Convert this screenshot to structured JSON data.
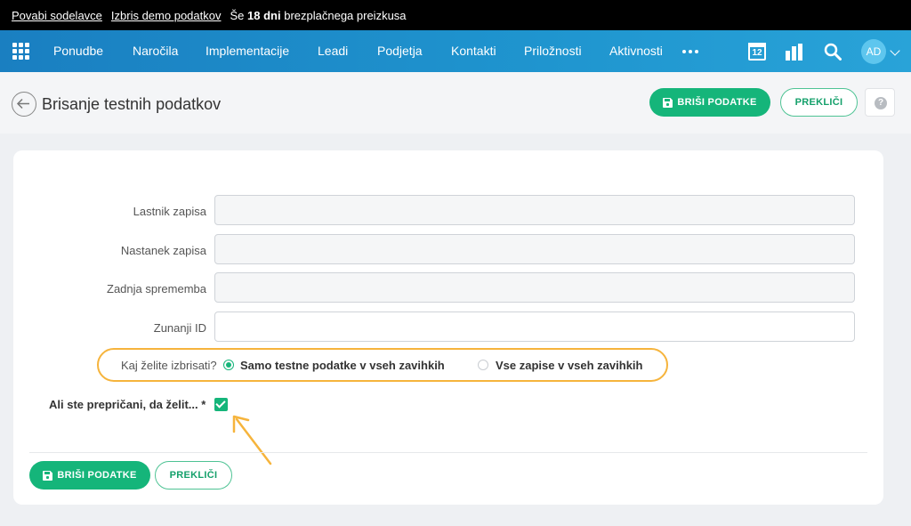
{
  "topbar": {
    "invite_link": "Povabi sodelavce",
    "delete_demo_link": "Izbris demo podatkov",
    "trial_prefix": "Še",
    "trial_days": "18 dni",
    "trial_suffix": "brezplačnega preizkusa"
  },
  "nav": {
    "items": [
      "Ponudbe",
      "Naročila",
      "Implementacije",
      "Leadi",
      "Podjetja",
      "Kontakti",
      "Priložnosti",
      "Aktivnosti"
    ],
    "calendar_day": "12",
    "avatar_initials": "AD"
  },
  "header": {
    "title": "Brisanje testnih podatkov",
    "delete_button": "BRIŠI PODATKE",
    "cancel_button": "PREKLIČI",
    "help": "?"
  },
  "form": {
    "fields": [
      {
        "label": "Lastnik zapisa",
        "value": ""
      },
      {
        "label": "Nastanek zapisa",
        "value": ""
      },
      {
        "label": "Zadnja sprememba",
        "value": ""
      },
      {
        "label": "Zunanji ID",
        "value": ""
      }
    ],
    "question": "Kaj želite izbrisati?",
    "options": [
      {
        "label": "Samo testne podatke v vseh zavihkih",
        "selected": true
      },
      {
        "label": "Vse zapise v vseh zavihkih",
        "selected": false
      }
    ],
    "confirm_label": "Ali ste prepričani, da želit... *",
    "confirm_checked": true
  },
  "footer": {
    "delete_button": "BRIŠI PODATKE",
    "cancel_button": "PREKLIČI"
  },
  "colors": {
    "accent_green": "#15b57a",
    "highlight_orange": "#f6b43c",
    "nav_blue": "#1f95cf"
  }
}
